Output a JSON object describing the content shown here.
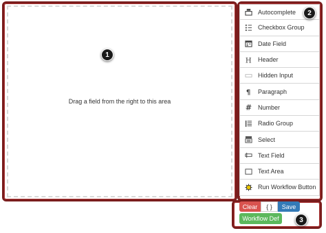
{
  "stage": {
    "placeholder": "Drag a field from the right to this area"
  },
  "controls": [
    {
      "label": "Autocomplete",
      "icon": "autocomplete-icon"
    },
    {
      "label": "Checkbox Group",
      "icon": "checkbox-group-icon"
    },
    {
      "label": "Date Field",
      "icon": "calendar-icon"
    },
    {
      "label": "Header",
      "icon": "header-icon"
    },
    {
      "label": "Hidden Input",
      "icon": "hidden-input-icon"
    },
    {
      "label": "Paragraph",
      "icon": "paragraph-icon"
    },
    {
      "label": "Number",
      "icon": "hash-icon"
    },
    {
      "label": "Radio Group",
      "icon": "radio-group-icon"
    },
    {
      "label": "Select",
      "icon": "select-icon"
    },
    {
      "label": "Text Field",
      "icon": "text-field-icon"
    },
    {
      "label": "Text Area",
      "icon": "text-area-icon"
    },
    {
      "label": "Run Workflow Button",
      "icon": "workflow-icon"
    }
  ],
  "actions": {
    "clear": "Clear",
    "json": "{ }",
    "save": "Save",
    "workflow_def": "Workflow Def"
  },
  "callouts": {
    "one": "1",
    "two": "2",
    "three": "3"
  },
  "colors": {
    "callout_frame": "#7a1d1d",
    "clear": "#d9534f",
    "save": "#337ab7",
    "workflow": "#5cb85c"
  }
}
